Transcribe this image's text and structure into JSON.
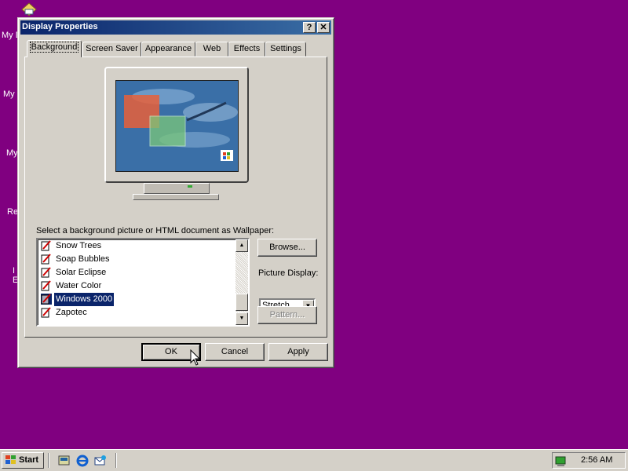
{
  "desktop": {
    "icons": [
      "My D",
      "My",
      "My",
      "Re",
      "I",
      "E"
    ]
  },
  "window": {
    "title": "Display Properties",
    "help_btn": "?",
    "close_btn": "✕"
  },
  "tabs": [
    "Background",
    "Screen Saver",
    "Appearance",
    "Web",
    "Effects",
    "Settings"
  ],
  "background_tab": {
    "wallpaper_label": "Select a background picture or HTML document as Wallpaper:",
    "wallpapers": [
      "Snow Trees",
      "Soap Bubbles",
      "Solar Eclipse",
      "Water Color",
      "Windows 2000",
      "Zapotec"
    ],
    "selected_wallpaper": "Windows 2000",
    "browse_label": "Browse...",
    "picture_display_label": "Picture Display:",
    "picture_display_value": "Stretch",
    "pattern_label": "Pattern..."
  },
  "dialog_buttons": {
    "ok": "OK",
    "cancel": "Cancel",
    "apply": "Apply"
  },
  "taskbar": {
    "start_label": "Start",
    "clock": "2:56 AM"
  }
}
